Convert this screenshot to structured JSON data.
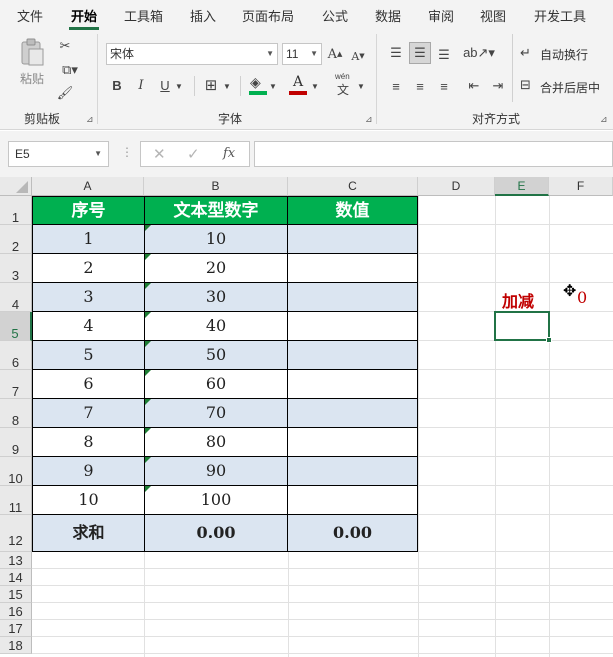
{
  "menu": {
    "items": [
      "文件",
      "开始",
      "工具箱",
      "插入",
      "页面布局",
      "公式",
      "数据",
      "审阅",
      "视图",
      "开发工具"
    ],
    "active": "开始"
  },
  "ribbon": {
    "clipboard": {
      "label": "剪贴板",
      "paste": "粘贴"
    },
    "font": {
      "label": "字体",
      "font_name": "宋体",
      "font_size": "11",
      "bold": "B",
      "italic": "I",
      "underline": "U",
      "grow": "A",
      "shrink": "A",
      "phonetic_top": "wén",
      "phonetic_bottom": "文",
      "font_color_letter": "A"
    },
    "alignment": {
      "label": "对齐方式",
      "wrap_text": "自动换行",
      "merge_center": "合并后居中"
    }
  },
  "formula_bar": {
    "name_box": "E5",
    "fx": "fx",
    "value": ""
  },
  "columns": [
    "A",
    "B",
    "C",
    "D",
    "E",
    "F"
  ],
  "selected_column": "E",
  "rows": [
    "1",
    "2",
    "3",
    "4",
    "5",
    "6",
    "7",
    "8",
    "9",
    "10",
    "11",
    "12",
    "13",
    "14",
    "15",
    "16",
    "17",
    "18"
  ],
  "selected_row": "5",
  "table": {
    "headers": [
      "序号",
      "文本型数字",
      "数值"
    ],
    "rows": [
      [
        "1",
        "10",
        ""
      ],
      [
        "2",
        "20",
        ""
      ],
      [
        "3",
        "30",
        ""
      ],
      [
        "4",
        "40",
        ""
      ],
      [
        "5",
        "50",
        ""
      ],
      [
        "6",
        "60",
        ""
      ],
      [
        "7",
        "70",
        ""
      ],
      [
        "8",
        "80",
        ""
      ],
      [
        "9",
        "90",
        ""
      ],
      [
        "10",
        "100",
        ""
      ]
    ],
    "total": [
      "求和",
      "0.00",
      "0.00"
    ]
  },
  "side": {
    "label": "加减",
    "value": "0"
  },
  "colors": {
    "header_fill": "#00b050",
    "band_fill": "#dbe5f1",
    "accent": "#217346",
    "red": "#c00000"
  }
}
